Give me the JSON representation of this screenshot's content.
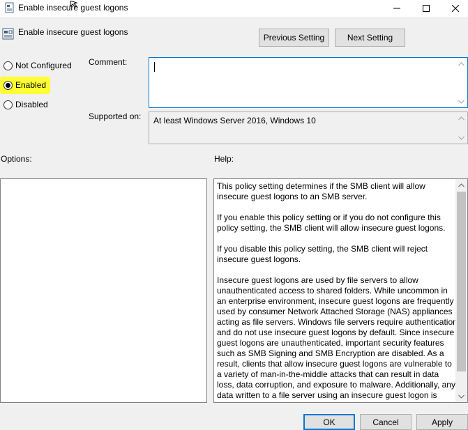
{
  "window": {
    "title": "Enable insecure guest logons",
    "controls": {
      "minimize": "minimize-icon",
      "maximize": "maximize-icon",
      "close": "close-icon"
    }
  },
  "policy": {
    "name": "Enable insecure guest logons",
    "icon": "policy-setting-icon"
  },
  "nav": {
    "previous_label": "Previous Setting",
    "next_label": "Next Setting"
  },
  "state": {
    "options": [
      {
        "label": "Not Configured",
        "checked": false
      },
      {
        "label": "Enabled",
        "checked": true
      },
      {
        "label": "Disabled",
        "checked": false
      }
    ],
    "highlight_color": "#ffff33"
  },
  "comment": {
    "label": "Comment:",
    "value": ""
  },
  "supported": {
    "label": "Supported on:",
    "value": "At least Windows Server 2016, Windows 10"
  },
  "options_panel": {
    "label": "Options:"
  },
  "help_panel": {
    "label": "Help:",
    "paragraphs": [
      "This policy setting determines if the SMB client will allow insecure guest logons to an SMB server.",
      "If you enable this policy setting or if you do not configure this policy setting, the SMB client will allow insecure guest logons.",
      "If you disable this policy setting, the SMB client will reject insecure guest logons.",
      "Insecure guest logons are used by file servers to allow unauthenticated access to shared folders. While uncommon in an enterprise environment, insecure guest logons are frequently used by consumer Network Attached Storage (NAS) appliances acting as file servers. Windows file servers require authentication and do not use insecure guest logons by default. Since insecure guest logons are unauthenticated, important security features such as SMB Signing and SMB Encryption are disabled. As a result, clients that allow insecure guest logons are vulnerable to a variety of man-in-the-middle attacks that can result in data loss, data corruption, and exposure to malware. Additionally, any data written to a file server using an insecure guest logon is"
    ]
  },
  "footer": {
    "ok_label": "OK",
    "cancel_label": "Cancel",
    "apply_label": "Apply"
  },
  "colors": {
    "accent": "#0078d7",
    "dialog_bg": "#f0f0f0"
  }
}
